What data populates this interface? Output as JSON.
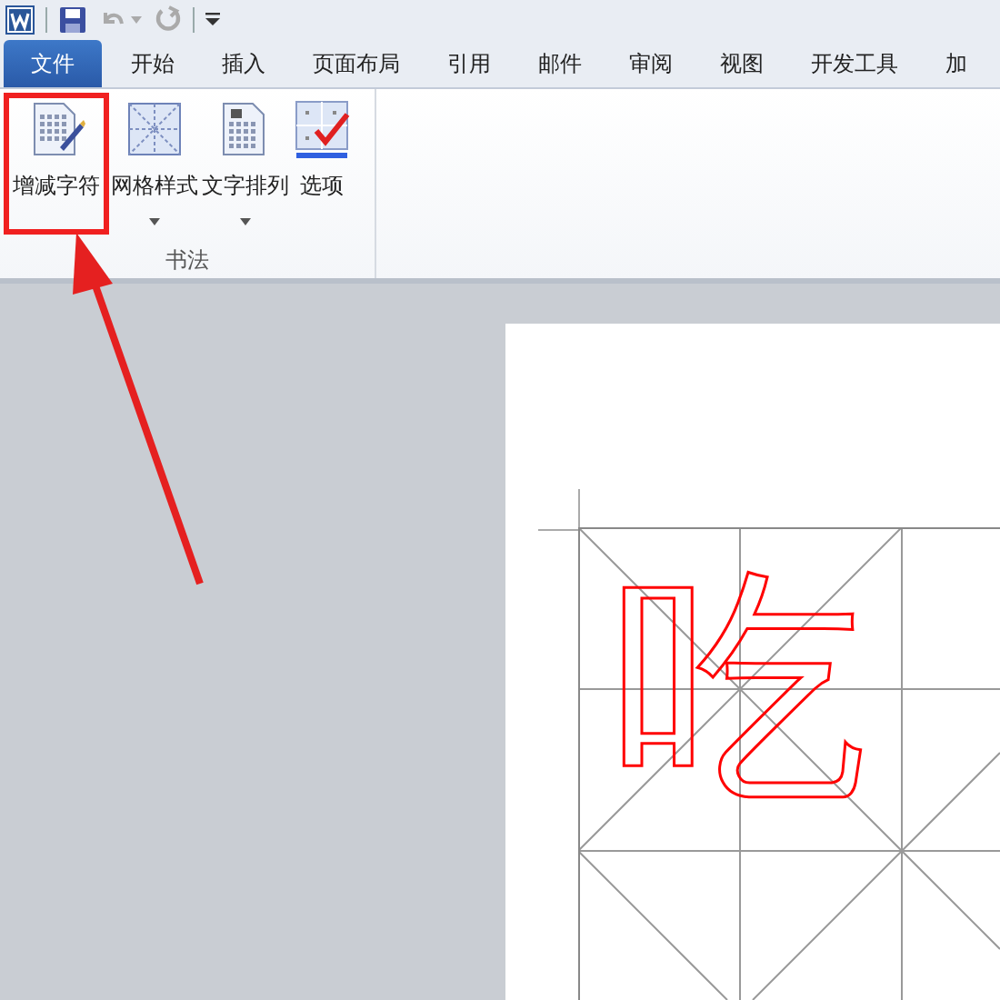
{
  "tabs": [
    {
      "label": "文件",
      "selected": true
    },
    {
      "label": "开始",
      "selected": false
    },
    {
      "label": "插入",
      "selected": false
    },
    {
      "label": "页面布局",
      "selected": false
    },
    {
      "label": "引用",
      "selected": false
    },
    {
      "label": "邮件",
      "selected": false
    },
    {
      "label": "审阅",
      "selected": false
    },
    {
      "label": "视图",
      "selected": false
    },
    {
      "label": "开发工具",
      "selected": false
    },
    {
      "label": "加",
      "selected": false
    }
  ],
  "ribbon": {
    "group_label": "书法",
    "buttons": [
      {
        "label": "增减字符",
        "kind": "pen",
        "dropdown": false,
        "highlighted": true
      },
      {
        "label": "网格样式",
        "kind": "grid",
        "dropdown": true,
        "highlighted": false
      },
      {
        "label": "文字排列",
        "kind": "doc",
        "dropdown": true,
        "highlighted": false
      },
      {
        "label": "选项",
        "kind": "check",
        "dropdown": false,
        "highlighted": false
      }
    ]
  },
  "page": {
    "characters": [
      "吃"
    ]
  }
}
